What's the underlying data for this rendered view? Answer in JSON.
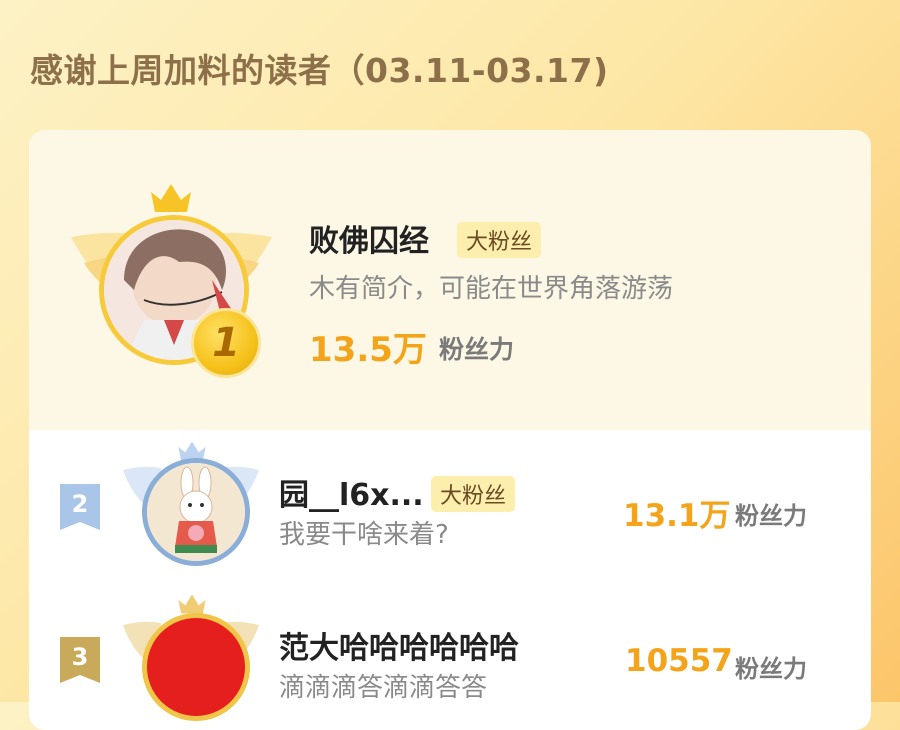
{
  "header": {
    "title": "感谢上周加料的读者（03.11-03.17)"
  },
  "readers": [
    {
      "rank": "1",
      "name": "败佛囚经",
      "badge": "大粉丝",
      "intro": "木有简介，可能在世界角落游荡",
      "fan_value": "13.5万",
      "fan_label": "粉丝力",
      "avatar": "anime-character-avatar"
    },
    {
      "rank": "2",
      "name": "园__l6x...",
      "badge": "大粉丝",
      "intro": "我要干啥来着?",
      "fan_value": "13.1万",
      "fan_label": "粉丝力",
      "avatar": "rabbit-cartoon-avatar"
    },
    {
      "rank": "3",
      "name": "范大哈哈哈哈哈哈",
      "badge": "",
      "intro": "滴滴滴答滴滴答答",
      "fan_value": "10557",
      "fan_label": "粉丝力",
      "avatar": "red-circle-avatar"
    }
  ],
  "colors": {
    "accent_orange": "#f3a41a",
    "gold": "#f5c21a",
    "silver_ribbon": "#a9c5e8",
    "bronze_ribbon": "#c9a95a",
    "avatar3_red": "#e51e1e"
  }
}
